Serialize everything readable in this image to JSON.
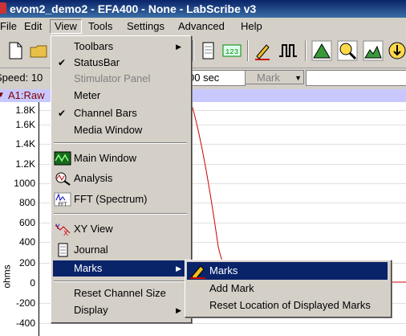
{
  "title": "evom2_demo2 - EFA400 - None - LabScribe v3",
  "menubar": {
    "items": [
      {
        "label": "File"
      },
      {
        "label": "Edit"
      },
      {
        "label": "View"
      },
      {
        "label": "Tools"
      },
      {
        "label": "Settings"
      },
      {
        "label": "Advanced"
      },
      {
        "label": "Help"
      }
    ]
  },
  "toolbar": {
    "buttons": [
      "new-file-icon",
      "open-folder-icon",
      "page-icon",
      "counter-icon",
      "pen-icon",
      "pulse-icon",
      "peak-icon",
      "zoom-icon",
      "mountain-icon",
      "download-icon"
    ],
    "counter_label": "123"
  },
  "status_row": {
    "speed_label": "Speed: 10",
    "time_value": "00 sec",
    "mark_label": "Mark",
    "mark_input_value": ""
  },
  "channel_bar": {
    "label": "A1:Raw"
  },
  "plot": {
    "y_ticks": [
      "1.8K",
      "1.6K",
      "1.4K",
      "1.2K",
      "1000",
      "800",
      "600",
      "400",
      "200",
      "0",
      "-200",
      "-400"
    ],
    "y_unit": "ohms"
  },
  "view_menu": {
    "items": [
      {
        "label": "Toolbars",
        "checked": false,
        "submenu": true,
        "disabled": false
      },
      {
        "label": "StatusBar",
        "checked": true,
        "submenu": false,
        "disabled": false
      },
      {
        "label": "Stimulator Panel",
        "checked": false,
        "submenu": false,
        "disabled": true
      },
      {
        "label": "Meter",
        "checked": false,
        "submenu": false,
        "disabled": false
      },
      {
        "label": "Channel Bars",
        "checked": true,
        "submenu": false,
        "disabled": false
      },
      {
        "label": "Media Window",
        "checked": false,
        "submenu": false,
        "disabled": false
      },
      {
        "label": "Main Window",
        "icon": "main-window-icon"
      },
      {
        "label": "Analysis",
        "icon": "analysis-icon"
      },
      {
        "label": "FFT (Spectrum)",
        "icon": "fft-icon"
      },
      {
        "label": "XY View",
        "icon": "xy-view-icon"
      },
      {
        "label": "Journal",
        "icon": "journal-icon"
      },
      {
        "label": "Marks",
        "submenu": true,
        "highlighted": true
      },
      {
        "label": "Reset Channel Size"
      },
      {
        "label": "Display",
        "submenu": true
      }
    ]
  },
  "marks_submenu": {
    "items": [
      {
        "label": "Marks",
        "icon": "pencil-icon",
        "highlighted": true
      },
      {
        "label": "Add Mark"
      },
      {
        "label": "Reset Location of Displayed Marks"
      }
    ]
  },
  "colors": {
    "title_bar": "#0a246a",
    "highlight": "#0a246a",
    "channel_bar": "#c8c8ff",
    "trace": "#cc0000"
  }
}
